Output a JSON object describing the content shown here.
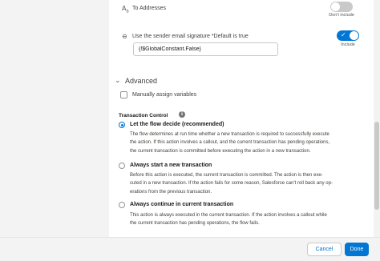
{
  "to_addresses": {
    "icon": "address-icon",
    "label": "To Addresses",
    "toggle_state": "off",
    "toggle_label": "Don't include"
  },
  "signature": {
    "icon": "link-icon",
    "label": "Use the sender email signature *Default is true",
    "value": "{!$GlobalConstant.False}",
    "toggle_state": "on",
    "toggle_label": "Include"
  },
  "advanced": {
    "title": "Advanced",
    "manual_assign_label": "Manually assign variables",
    "transaction_control_label": "Transaction Control",
    "options": [
      {
        "title": "Let the flow decide (recommended)",
        "selected": true,
        "desc": [
          "The flow determines at run time whether a new transaction is required to successfully execute",
          "the action. If this action involves a callout, and the current transaction has pending operations,",
          "the current transaction is committed before executing the action in a new transaction."
        ]
      },
      {
        "title": "Always start a new transaction",
        "selected": false,
        "desc": [
          "Before this action is executed, the current transaction is committed. The action is then exe-",
          "cuted in a new transaction. If the action fails for some reason, Salesforce can't roll back any op-",
          "erations from the previous transaction."
        ]
      },
      {
        "title": "Always continue in current transaction",
        "selected": false,
        "desc": [
          "This action is always executed in the current transaction. If the action involves a callout while",
          "the current transaction has pending operations, the flow fails."
        ]
      }
    ]
  },
  "footer": {
    "cancel_label": "Cancel",
    "done_label": "Done"
  }
}
